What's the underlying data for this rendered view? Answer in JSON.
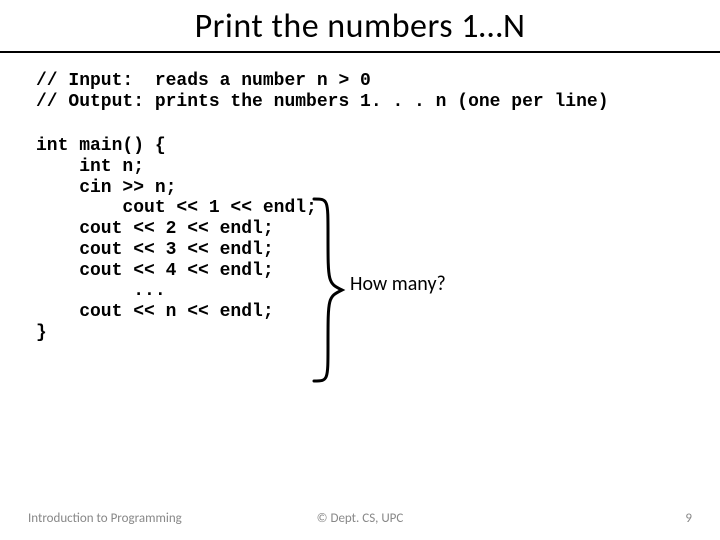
{
  "title": "Print the numbers 1…N",
  "comments": "// Input:  reads a number n > 0\n// Output: prints the numbers 1. . . n (one per line)",
  "code": "int main() {\n    int n;\n    cin >> n;\n        cout << 1 << endl;\n    cout << 2 << endl;\n    cout << 3 << endl;\n    cout << 4 << endl;\n         ...\n    cout << n << endl;\n}",
  "annotation": "How many?",
  "footer": {
    "left": "Introduction to Programming",
    "center": "© Dept. CS, UPC",
    "right": "9"
  }
}
